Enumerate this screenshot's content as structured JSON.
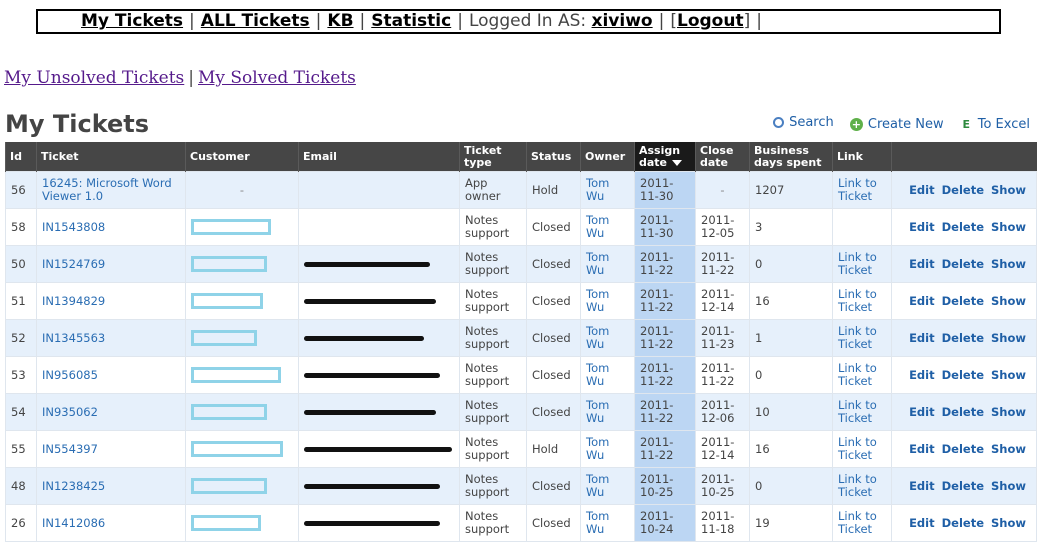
{
  "nav": {
    "my_tickets": "My Tickets",
    "all_tickets": "ALL Tickets",
    "kb": "KB",
    "statistic": "Statistic",
    "logged_in_label": "Logged In AS:",
    "username": "xiviwo",
    "logout": "Logout"
  },
  "sublinks": {
    "unsolved": "My Unsolved Tickets",
    "solved": "My Solved Tickets"
  },
  "page_title": "My Tickets",
  "actions": {
    "search": "Search",
    "create_new": "Create New",
    "to_excel": "To Excel",
    "excel_glyph": "E"
  },
  "table": {
    "headers": [
      "Id",
      "Ticket",
      "Customer",
      "Email",
      "Ticket type",
      "Status",
      "Owner",
      "Assign date",
      "Close date",
      "Business days spent",
      "Link",
      ""
    ],
    "rows": [
      {
        "id": "56",
        "ticket": "16245: Microsoft Word Viewer 1.0",
        "customer": "-",
        "email": "",
        "type": "App owner",
        "status": "Hold",
        "owner": "Tom Wu",
        "assign": "2011-11-30",
        "close": "-",
        "days": "1207",
        "link": "Link to Ticket"
      },
      {
        "id": "58",
        "ticket": "IN1543808",
        "customer": "",
        "email": "",
        "type": "Notes support",
        "status": "Closed",
        "owner": "Tom Wu",
        "assign": "2011-11-30",
        "close": "2011-12-05",
        "days": "3",
        "link": ""
      },
      {
        "id": "50",
        "ticket": "IN1524769",
        "customer": "",
        "email": "",
        "type": "Notes support",
        "status": "Closed",
        "owner": "Tom Wu",
        "assign": "2011-11-22",
        "close": "2011-11-22",
        "days": "0",
        "link": "Link to Ticket"
      },
      {
        "id": "51",
        "ticket": "IN1394829",
        "customer": "",
        "email": "",
        "type": "Notes support",
        "status": "Closed",
        "owner": "Tom Wu",
        "assign": "2011-11-22",
        "close": "2011-12-14",
        "days": "16",
        "link": "Link to Ticket"
      },
      {
        "id": "52",
        "ticket": "IN1345563",
        "customer": "",
        "email": "",
        "type": "Notes support",
        "status": "Closed",
        "owner": "Tom Wu",
        "assign": "2011-11-22",
        "close": "2011-11-23",
        "days": "1",
        "link": "Link to Ticket"
      },
      {
        "id": "53",
        "ticket": "IN956085",
        "customer": "",
        "email": "",
        "type": "Notes support",
        "status": "Closed",
        "owner": "Tom Wu",
        "assign": "2011-11-22",
        "close": "2011-11-22",
        "days": "0",
        "link": "Link to Ticket"
      },
      {
        "id": "54",
        "ticket": "IN935062",
        "customer": "",
        "email": "",
        "type": "Notes support",
        "status": "Closed",
        "owner": "Tom Wu",
        "assign": "2011-11-22",
        "close": "2011-12-06",
        "days": "10",
        "link": "Link to Ticket"
      },
      {
        "id": "55",
        "ticket": "IN554397",
        "customer": "",
        "email": "",
        "type": "Notes support",
        "status": "Hold",
        "owner": "Tom Wu",
        "assign": "2011-11-22",
        "close": "2011-12-14",
        "days": "16",
        "link": "Link to Ticket"
      },
      {
        "id": "48",
        "ticket": "IN1238425",
        "customer": "",
        "email": "",
        "type": "Notes support",
        "status": "Closed",
        "owner": "Tom Wu",
        "assign": "2011-10-25",
        "close": "2011-10-25",
        "days": "0",
        "link": "Link to Ticket"
      },
      {
        "id": "26",
        "ticket": "IN1412086",
        "customer": "",
        "email": "",
        "type": "Notes support",
        "status": "Closed",
        "owner": "Tom Wu",
        "assign": "2011-10-24",
        "close": "2011-11-18",
        "days": "19",
        "link": "Link to Ticket"
      }
    ],
    "row_actions": {
      "edit": "Edit",
      "delete": "Delete",
      "show": "Show"
    }
  },
  "colors": {
    "header_bg": "#464646",
    "row_alt": "#e6f0fb",
    "assign_col": "#bcd6f3",
    "link": "#2a6db3",
    "redaction": "#8fd3e8"
  }
}
